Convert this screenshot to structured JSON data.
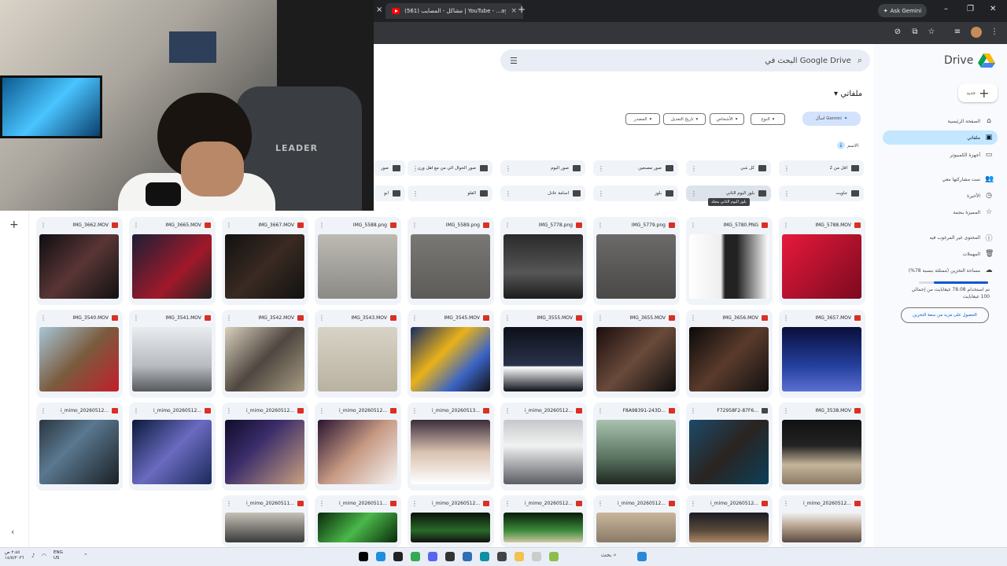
{
  "browser": {
    "active_tab_title": "(561) مشاكل - المصايب | YouTube - ...ayeb",
    "ask_gemini": "Ask Gemini"
  },
  "sidebar": {
    "drive_logo_text": "Drive",
    "new_label": "جديد",
    "items": [
      {
        "label": "الصفحة الرئيسية",
        "icon": "home-icon"
      },
      {
        "label": "ملفاتي",
        "icon": "my-drive-icon",
        "active": true
      },
      {
        "label": "أجهزة الكمبيوتر",
        "icon": "computer-icon"
      },
      {
        "label": "تمت مشاركتها معي",
        "icon": "people-icon"
      },
      {
        "label": "الأخيرة",
        "icon": "clock-icon"
      },
      {
        "label": "المميزة بنجمة",
        "icon": "star-icon"
      },
      {
        "label": "المحتوى غير المرغوب فيه",
        "icon": "spam-icon"
      },
      {
        "label": "المهملات",
        "icon": "trash-icon"
      },
      {
        "label": "مساحة التخزين (ممتلئة بنسبة 78%)",
        "icon": "cloud-icon"
      }
    ],
    "storage_used_text": "تم استخدام 78.08 غيغابايت من إجمالي 100 غيغابايت",
    "storage_fraction": 0.78,
    "get_storage": "الحصول على مزيد من سعة التخزين"
  },
  "search": {
    "placeholder": "البحث في Google Drive"
  },
  "page_title": "ملفاتي",
  "filters": {
    "gemini": "اسأل Gemini",
    "chips": [
      "النوع",
      "الأشخاص",
      "تاريخ التعديل",
      "المصدر"
    ]
  },
  "sort_label": "الاسم",
  "folders_row1": [
    "أقل من 2",
    "كل شي",
    "صور مصنعين",
    "صور اليوم",
    "صور الحوال الي من مع أهل ورن",
    "صور"
  ],
  "folders_row2": [
    "جاويت",
    "بلوز اليوم الثاني",
    "بلوز",
    "اسامة عادل",
    "الفلو",
    "ابو"
  ],
  "tooltip": "بلوز اليوم الثاني مجلد",
  "files": [
    {
      "name": "IMG_5788.MOV",
      "type": "video"
    },
    {
      "name": "IMG_5780.PNG",
      "type": "image"
    },
    {
      "name": "IMG_5779.png",
      "type": "image"
    },
    {
      "name": "IMG_5778.png",
      "type": "image"
    },
    {
      "name": "IMG_5589.png",
      "type": "image"
    },
    {
      "name": "IMG_5588.png",
      "type": "image"
    },
    {
      "name": "IMG_3667.MOV",
      "type": "video"
    },
    {
      "name": "IMG_3665.MOV",
      "type": "video"
    },
    {
      "name": "IMG_3662.MOV",
      "type": "video"
    },
    {
      "name": "IMG_3657.MOV",
      "type": "video"
    },
    {
      "name": "IMG_3656.MOV",
      "type": "video"
    },
    {
      "name": "IMG_3655.MOV",
      "type": "video"
    },
    {
      "name": "IMG_3555.MOV",
      "type": "video"
    },
    {
      "name": "IMG_3545.MOV",
      "type": "video"
    },
    {
      "name": "IMG_3543.MOV",
      "type": "video"
    },
    {
      "name": "IMG_3542.MOV",
      "type": "video"
    },
    {
      "name": "IMG_3541.MOV",
      "type": "video"
    },
    {
      "name": "IMG_3540.MOV",
      "type": "video"
    },
    {
      "name": "IMG_3538.MOV",
      "type": "video"
    },
    {
      "name": "F72958F2-87F6...",
      "type": "folder"
    },
    {
      "name": "F8A98391-243D...",
      "type": "video"
    },
    {
      "name": "i_mimo_20260512...",
      "type": "video"
    },
    {
      "name": "i_mimo_20260513...",
      "type": "video"
    },
    {
      "name": "i_mimo_20260512...",
      "type": "video"
    },
    {
      "name": "i_mimo_20260512...",
      "type": "video"
    },
    {
      "name": "i_mimo_20260512...",
      "type": "video"
    },
    {
      "name": "i_mimo_20260512...",
      "type": "video"
    },
    {
      "name": "i_mimo_20260512...",
      "type": "video"
    },
    {
      "name": "i_mimo_20260512...",
      "type": "video"
    },
    {
      "name": "i_mimo_20260512...",
      "type": "video"
    },
    {
      "name": "i_mimo_20260512...",
      "type": "video"
    },
    {
      "name": "i_mimo_20260512...",
      "type": "video"
    },
    {
      "name": "i_mimo_20260511...",
      "type": "video"
    },
    {
      "name": "i_mimo_20260511...",
      "type": "video"
    }
  ],
  "taskbar": {
    "time": "٢:٤٥ ص",
    "date": "١٤/٥/٢٠٢٦",
    "lang": "ENG",
    "region": "US",
    "search": "بحث"
  },
  "webcam": {
    "chair_brand": "LEADER"
  },
  "colors": {
    "accent": "#0b57d0",
    "selected_nav": "#c2e7ff",
    "surface": "#f0f4f9"
  }
}
